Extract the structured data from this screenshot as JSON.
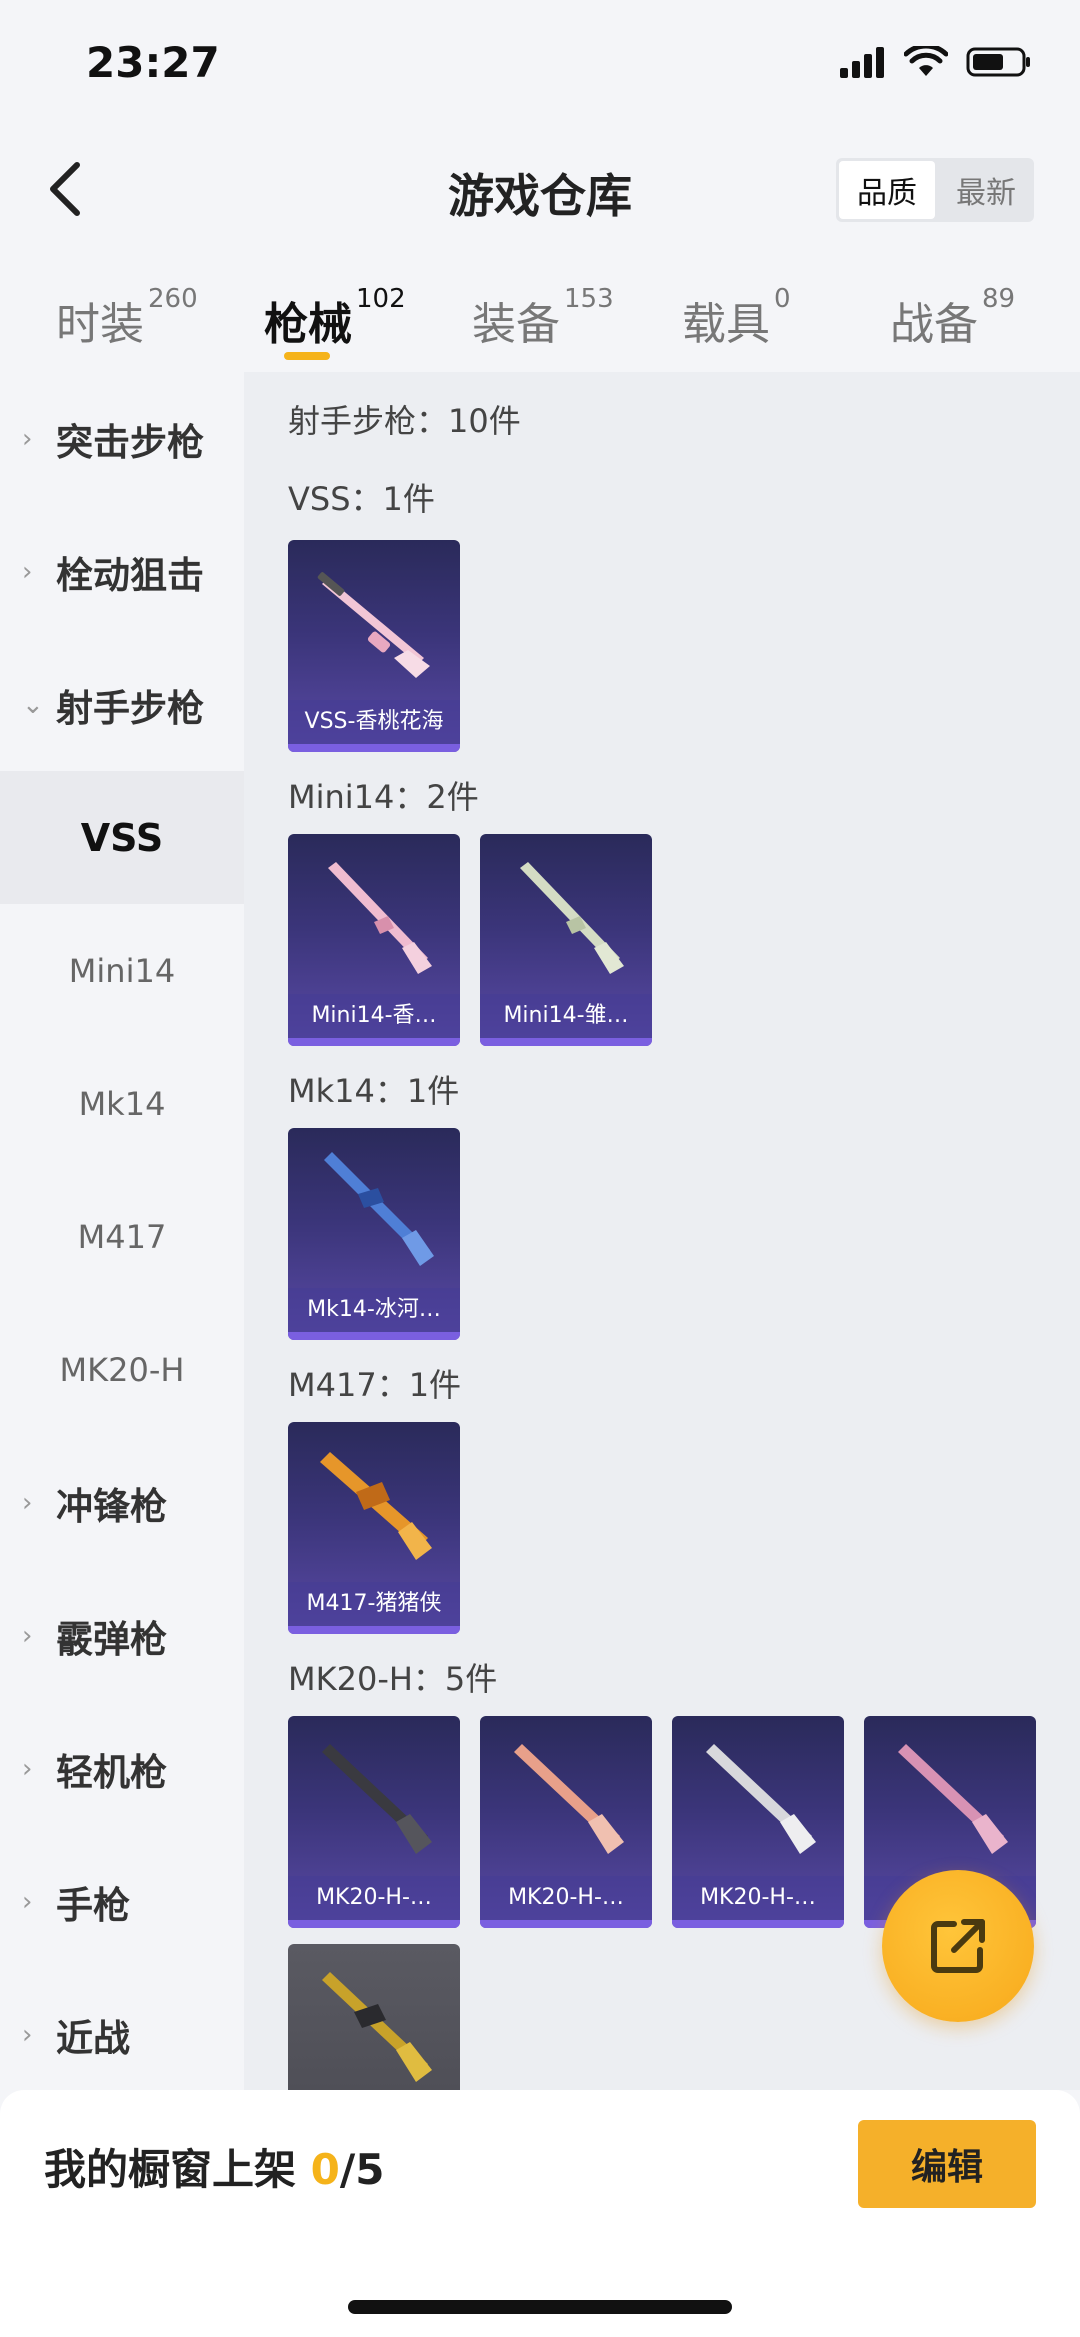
{
  "status_bar": {
    "time": "23:27"
  },
  "header": {
    "title": "游戏仓库",
    "sort_options": [
      "品质",
      "最新"
    ]
  },
  "tabs": [
    {
      "label": "时装",
      "count": "260"
    },
    {
      "label": "枪械",
      "count": "102"
    },
    {
      "label": "装备",
      "count": "153"
    },
    {
      "label": "载具",
      "count": "0"
    },
    {
      "label": "战备",
      "count": "89"
    }
  ],
  "sidebar": {
    "categories": [
      "突击步枪",
      "栓动狙击",
      "射手步枪",
      "冲锋枪",
      "霰弹枪",
      "轻机枪",
      "手枪",
      "近战"
    ],
    "subitems": [
      "VSS",
      "Mini14",
      "Mk14",
      "M417",
      "MK20-H"
    ]
  },
  "content": {
    "category_title": "射手步枪：10件",
    "sections": [
      {
        "title": "VSS：1件",
        "items": [
          "VSS-香桃花海"
        ]
      },
      {
        "title": "Mini14：2件",
        "items": [
          "Mini14-香…",
          "Mini14-雏…"
        ]
      },
      {
        "title": "Mk14：1件",
        "items": [
          "Mk14-冰河…"
        ]
      },
      {
        "title": "M417：1件",
        "items": [
          "M417-猪猪侠"
        ]
      },
      {
        "title": "MK20-H：5件",
        "items": [
          "MK20-H-…",
          "MK20-H-…",
          "MK20-H-…",
          "M…"
        ]
      }
    ]
  },
  "bottom_bar": {
    "label": "我的橱窗上架 ",
    "current": "0",
    "total": "/5",
    "edit_label": "编辑"
  },
  "colors": {
    "accent": "#f5b31a",
    "card_bg": "#3b357a"
  }
}
